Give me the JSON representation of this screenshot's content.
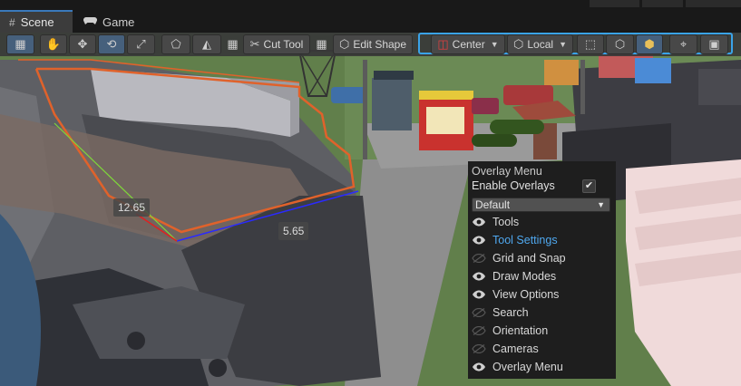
{
  "tabs": [
    {
      "label": "Scene",
      "icon": "grid-icon",
      "active": true
    },
    {
      "label": "Game",
      "icon": "gamepad-icon",
      "active": false
    }
  ],
  "toolbar": {
    "cut_tool_label": "Cut Tool",
    "edit_shape_label": "Edit Shape",
    "pivot_label": "Center",
    "space_label": "Local"
  },
  "measures": {
    "left": "12.65",
    "right": "5.65"
  },
  "overlay_menu": {
    "title": "Overlay Menu",
    "enable_label": "Enable Overlays",
    "enable_checked": true,
    "preset": "Default",
    "items": [
      {
        "label": "Tools",
        "visible": true,
        "active": false
      },
      {
        "label": "Tool Settings",
        "visible": true,
        "active": true
      },
      {
        "label": "Grid and Snap",
        "visible": false,
        "active": false
      },
      {
        "label": "Draw Modes",
        "visible": true,
        "active": false
      },
      {
        "label": "View Options",
        "visible": true,
        "active": false
      },
      {
        "label": "Search",
        "visible": false,
        "active": false
      },
      {
        "label": "Orientation",
        "visible": false,
        "active": false
      },
      {
        "label": "Cameras",
        "visible": false,
        "active": false
      },
      {
        "label": "Overlay Menu",
        "visible": true,
        "active": false
      }
    ]
  },
  "colors": {
    "accent": "#3aa3e8",
    "active_item": "#4fa8ef"
  }
}
